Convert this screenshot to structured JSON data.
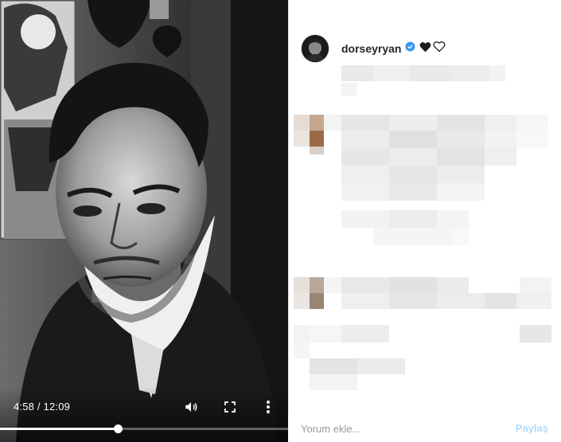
{
  "video": {
    "time_display": "4:58 / 12:09",
    "progress_fraction": 0.41
  },
  "post": {
    "username": "dorseyryan",
    "verified": true,
    "title_emojis": [
      "black-heart",
      "white-heart"
    ]
  },
  "comment_box": {
    "placeholder": "Yorum ekle...",
    "share_label": "Paylaş"
  },
  "colors": {
    "verified_badge": "#3897f0",
    "share_disabled": "#b3dbff",
    "text": "#262626"
  },
  "icons": [
    "volume-icon",
    "fullscreen-icon",
    "more-vertical-icon",
    "verified-badge-icon",
    "black-heart-icon",
    "white-heart-icon"
  ]
}
